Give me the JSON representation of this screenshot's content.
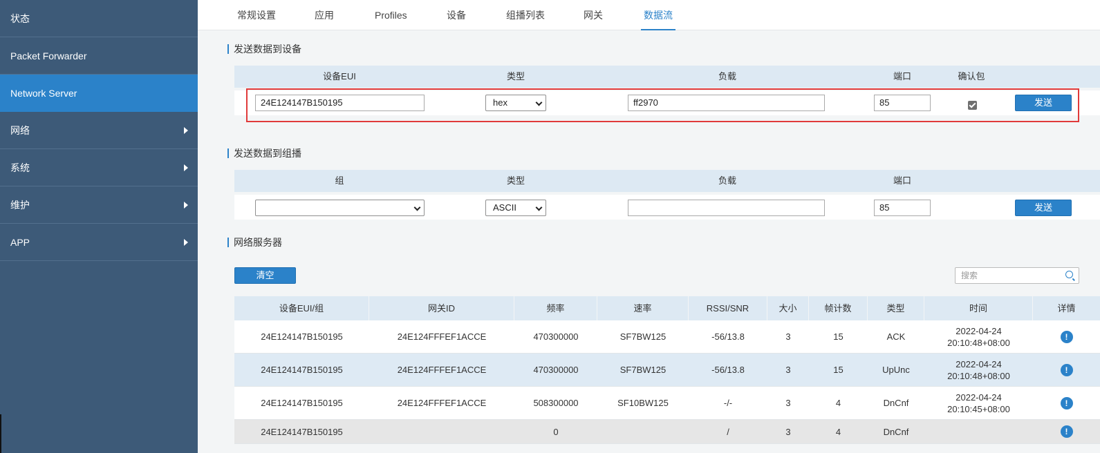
{
  "sidebar": {
    "items": [
      {
        "label": "状态",
        "has_arrow": false,
        "active": false
      },
      {
        "label": "Packet Forwarder",
        "has_arrow": false,
        "active": false
      },
      {
        "label": "Network Server",
        "has_arrow": false,
        "active": true
      },
      {
        "label": "网络",
        "has_arrow": true,
        "active": false
      },
      {
        "label": "系统",
        "has_arrow": true,
        "active": false
      },
      {
        "label": "维护",
        "has_arrow": true,
        "active": false
      },
      {
        "label": "APP",
        "has_arrow": true,
        "active": false
      }
    ]
  },
  "tabs": [
    "常规设置",
    "应用",
    "Profiles",
    "设备",
    "组播列表",
    "网关",
    "数据流"
  ],
  "active_tab": "数据流",
  "send_device": {
    "title": "发送数据到设备",
    "headers": {
      "eui": "设备EUI",
      "type": "类型",
      "payload": "负载",
      "port": "端口",
      "confirm": "确认包"
    },
    "values": {
      "eui": "24E124147B150195",
      "type": "hex",
      "payload": "ff2970",
      "port": "85",
      "confirm": true
    },
    "send_label": "发送"
  },
  "send_multicast": {
    "title": "发送数据到组播",
    "headers": {
      "group": "组",
      "type": "类型",
      "payload": "负载",
      "port": "端口"
    },
    "values": {
      "group": "",
      "type": "ASCII",
      "payload": "",
      "port": "85"
    },
    "send_label": "发送"
  },
  "network_server": {
    "title": "网络服务器",
    "clear_label": "清空",
    "search_placeholder": "搜索",
    "columns": [
      "设备EUI/组",
      "网关ID",
      "频率",
      "速率",
      "RSSI/SNR",
      "大小",
      "帧计数",
      "类型",
      "时间",
      "详情"
    ],
    "rows": [
      {
        "eui": "24E124147B150195",
        "gateway": "24E124FFFEF1ACCE",
        "freq": "470300000",
        "rate": "SF7BW125",
        "rssi": "-56/13.8",
        "size": "3",
        "fcnt": "15",
        "type": "ACK",
        "date": "2022-04-24",
        "time": "20:10:48+08:00"
      },
      {
        "eui": "24E124147B150195",
        "gateway": "24E124FFFEF1ACCE",
        "freq": "470300000",
        "rate": "SF7BW125",
        "rssi": "-56/13.8",
        "size": "3",
        "fcnt": "15",
        "type": "UpUnc",
        "date": "2022-04-24",
        "time": "20:10:48+08:00"
      },
      {
        "eui": "24E124147B150195",
        "gateway": "24E124FFFEF1ACCE",
        "freq": "508300000",
        "rate": "SF10BW125",
        "rssi": "-/-",
        "size": "3",
        "fcnt": "4",
        "type": "DnCnf",
        "date": "2022-04-24",
        "time": "20:10:45+08:00"
      },
      {
        "eui": "24E124147B150195",
        "gateway": "",
        "freq": "0",
        "rate": "",
        "rssi": "/",
        "size": "3",
        "fcnt": "4",
        "type": "DnCnf",
        "date": "",
        "time": ""
      }
    ],
    "detail_icon": "info-icon"
  },
  "colors": {
    "accent": "#2b82c9",
    "sidebar": "#3d5a78",
    "highlight": "#e03a3a"
  }
}
